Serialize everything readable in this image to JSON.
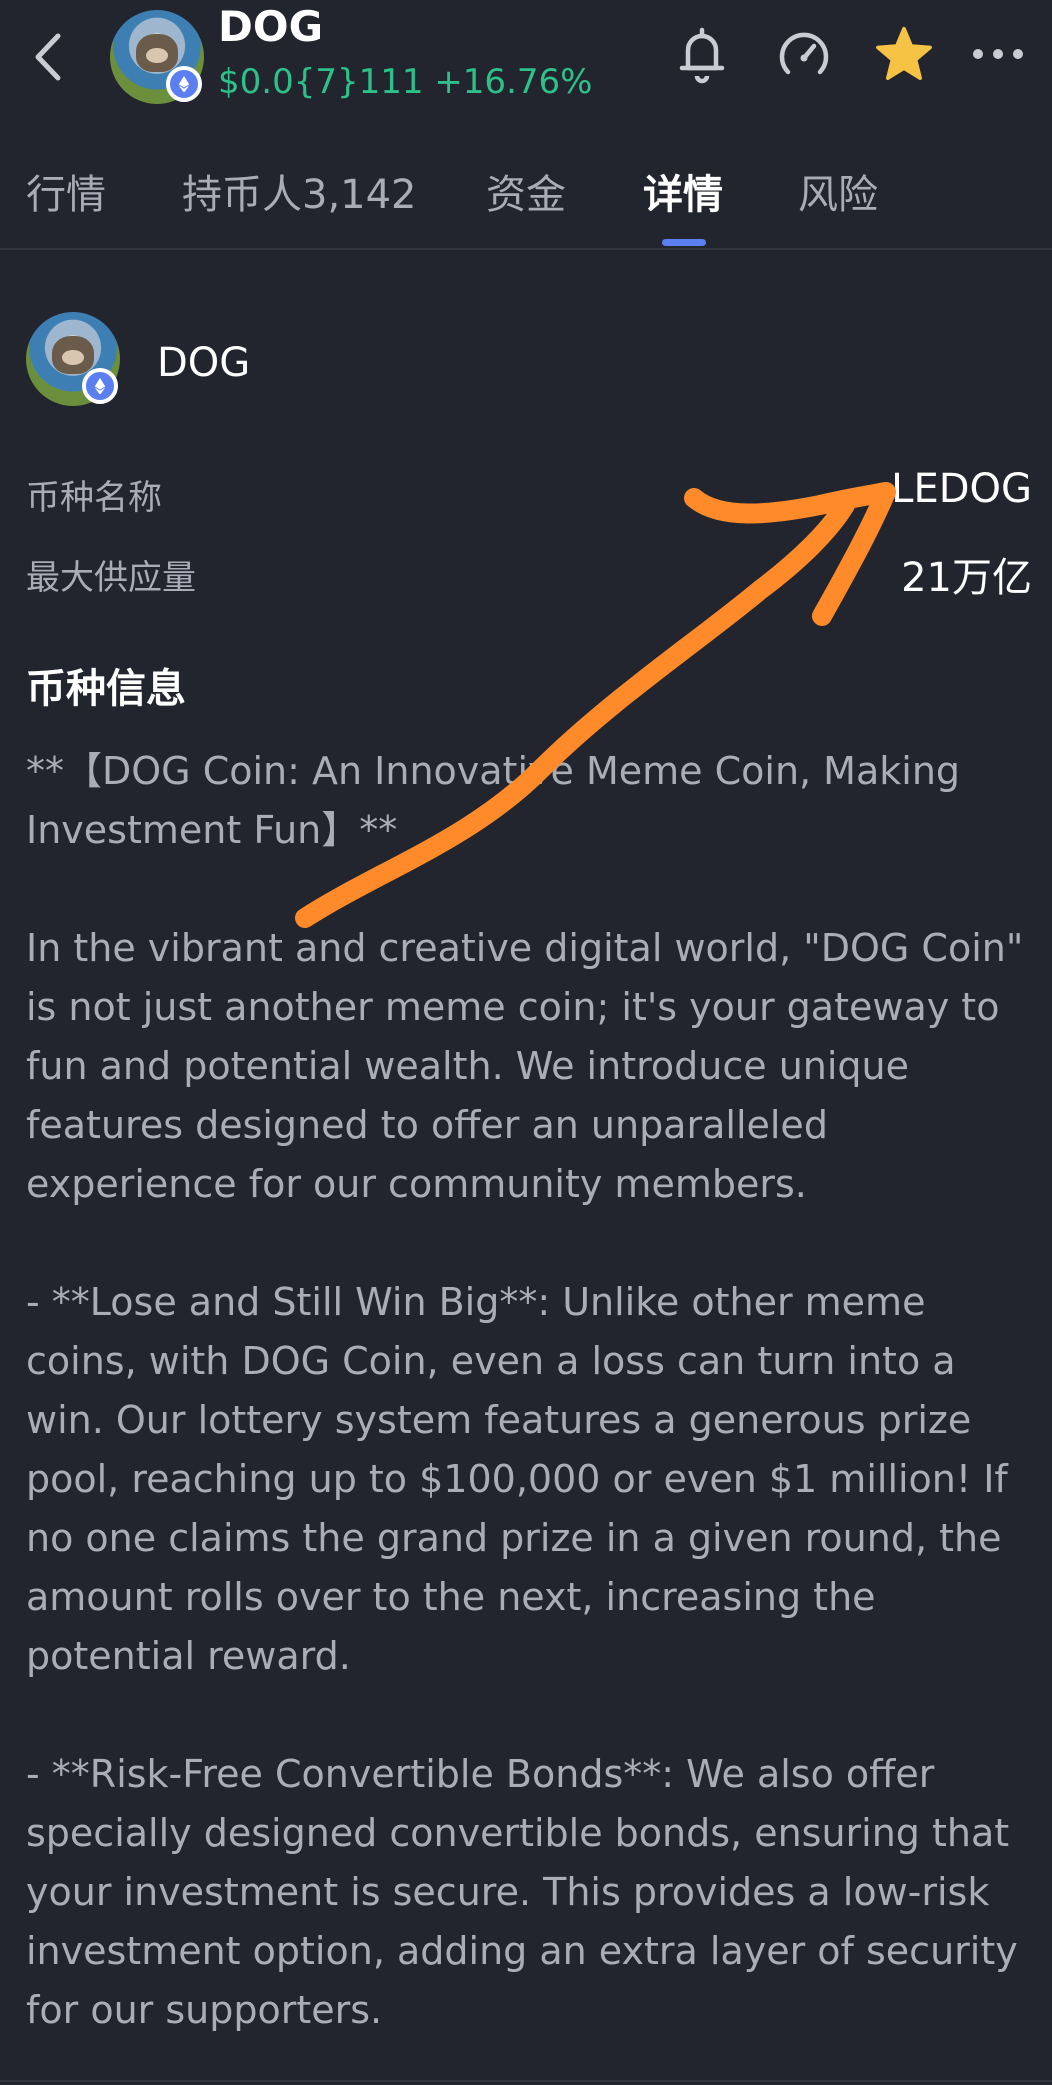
{
  "header": {
    "title": "DOG",
    "price": "$0.0{7}111",
    "change": "+16.76%",
    "star_color": "#f6c244"
  },
  "tabs": [
    {
      "label": "行情"
    },
    {
      "label": "持币人3,142"
    },
    {
      "label": "资金"
    },
    {
      "label": "详情",
      "active": true
    },
    {
      "label": "风险"
    }
  ],
  "token": {
    "name": "DOG",
    "fields": [
      {
        "label": "币种名称",
        "value": "LEDOG"
      },
      {
        "label": "最大供应量",
        "value": "21万亿"
      }
    ]
  },
  "info": {
    "title": "币种信息",
    "paragraphs": [
      "**【DOG Coin: An Innovative Meme Coin, Making Investment Fun】**",
      "In the vibrant and creative digital world, \"DOG Coin\" is not just another meme coin; it's your gateway to fun and potential wealth. We introduce unique features designed to offer an unparalleled experience for our community members.",
      "- **Lose and Still Win Big**: Unlike other meme coins, with DOG Coin, even a loss can turn into a win. Our lottery system features a generous prize pool, reaching up to $100,000 or even $1 million! If no one claims the grand prize in a given round, the amount rolls over to the next, increasing the potential reward.",
      "- **Risk-Free Convertible Bonds**: We also offer specially designed convertible bonds, ensuring that your investment is secure. This provides a low-risk investment option, adding an extra layer of security for our supporters."
    ]
  },
  "colors": {
    "background": "#22252e",
    "accent": "#5b7ff0",
    "positive": "#2ec08a",
    "annotation_arrow": "#ff8a2a"
  }
}
